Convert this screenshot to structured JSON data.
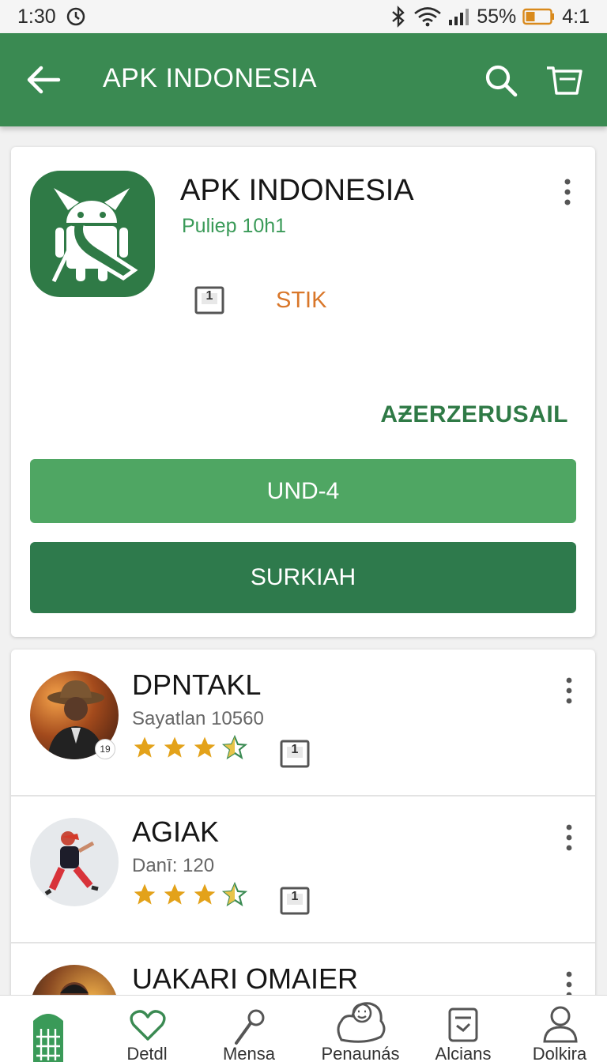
{
  "status_bar": {
    "time": "1:30",
    "battery": "55%",
    "extra": "4:1"
  },
  "app_bar": {
    "title": "APK INDONESIA"
  },
  "hero": {
    "app_name": "APK INDONESIA",
    "developer": "Puliep 10h1",
    "badge": "1",
    "tag": "STIK",
    "brand": "AƵERZERUSAIL",
    "primary_button": "UND-4",
    "secondary_button": "SURKIAH"
  },
  "list": {
    "items": [
      {
        "title": "DPNTAKL",
        "subtitle": "Sayatlan 10560",
        "rating": 3.5,
        "badge": "1",
        "avatar_badge": "19"
      },
      {
        "title": "AGIAK",
        "subtitle": "Danī: 120",
        "rating": 3.5,
        "badge": "1"
      },
      {
        "title": "UAKARI OMAIER"
      }
    ]
  },
  "bottom_nav": {
    "items": [
      {
        "label": "",
        "icon": "building-icon"
      },
      {
        "label": "Detdl",
        "icon": "heart-icon"
      },
      {
        "label": "Mensa",
        "icon": "microphone-icon"
      },
      {
        "label": "Penaunás",
        "icon": "chat-face-icon"
      },
      {
        "label": "Alcians",
        "icon": "clipboard-icon"
      },
      {
        "label": "Dolkira",
        "icon": "person-icon"
      }
    ]
  },
  "colors": {
    "primary": "#3a8a52",
    "button_light": "#4fa663",
    "button_dark": "#2e7a4c",
    "tag": "#d9772a",
    "star": "#e3a21a"
  }
}
